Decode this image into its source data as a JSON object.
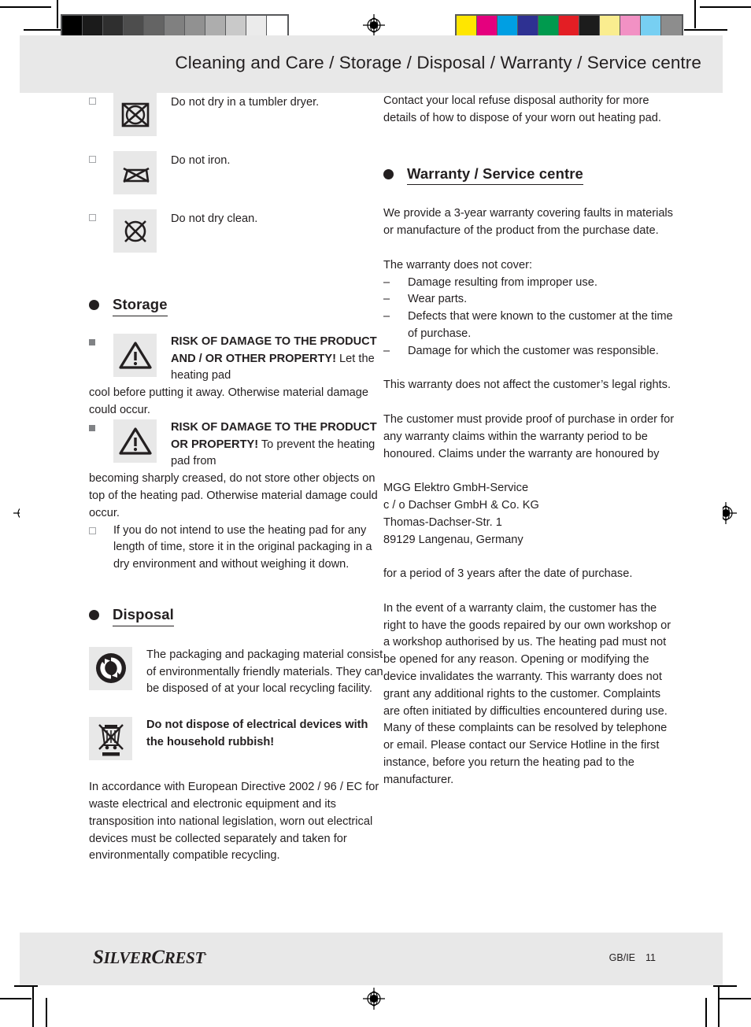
{
  "page": {
    "header_title": "Cleaning and Care / Storage / Disposal / Warranty / Service centre",
    "footer_logo_silver": "S",
    "footer_logo_ilver": "ILVER",
    "footer_logo_c": "C",
    "footer_logo_rest": "REST",
    "footer_logo_regmark": "·",
    "footer_locale": "GB/IE",
    "footer_pagenum": "11"
  },
  "calibration": {
    "gray_swatches": [
      "#000000",
      "#1b1b1b",
      "#2f2f2f",
      "#4d4d4d",
      "#646464",
      "#808080",
      "#919191",
      "#adadad",
      "#c9c9c9",
      "#ebebeb",
      "#ffffff"
    ],
    "color_swatches": [
      "#ffe600",
      "#e5007e",
      "#009fe3",
      "#2e3192",
      "#009a4e",
      "#e31e24",
      "#1c1c1c",
      "#faed8f",
      "#f291c4",
      "#77cff2",
      "#8d8d8d"
    ]
  },
  "left_column": {
    "care_symbols": [
      {
        "icon": "no-tumble-dry-icon",
        "label": "Do not dry in a tumbler dryer."
      },
      {
        "icon": "no-iron-icon",
        "label": "Do not iron."
      },
      {
        "icon": "no-dry-clean-icon",
        "label": "Do not dry clean."
      }
    ],
    "storage": {
      "heading": "Storage",
      "warning_1": {
        "strong": "RISK OF DAMAGE TO THE PRODUCT AND / OR OTHER PROPERTY!",
        "rest_inline": " Let the heating pad",
        "continuation": "cool before putting it away. Otherwise material damage could occur."
      },
      "warning_2": {
        "strong": "RISK OF DAMAGE TO THE PRODUCT OR PROPERTY!",
        "rest_inline": " To prevent the heating pad from",
        "continuation": "becoming sharply creased, do not store other objects on top of the heating pad. Otherwise material damage could occur."
      },
      "bullet_item": "If you do not intend to use the heating pad for any length of time, store it in the original packaging in a dry environment and without weighing it down."
    },
    "disposal": {
      "heading": "Disposal",
      "recycling_text": "The packaging and packaging material consist of environmentally friendly materials. They can be disposed of at your local recycling facility.",
      "weee_text": "Do not dispose of electrical devices with the household rubbish!",
      "directive_text": "In accordance with European Directive 2002 / 96 / EC for waste electrical and electronic equipment and its transposition into national legislation, worn out electrical devices must be collected separately and taken for environmentally compatible recycling."
    }
  },
  "right_column": {
    "refuse_text": "Contact your local refuse disposal authority for more details of how to dispose of your worn out heating pad.",
    "warranty": {
      "heading": "Warranty / Service centre",
      "intro": "We provide a 3-year warranty covering faults in materials or manufacture of the product from the purchase date.",
      "not_cover_label": "The warranty does not cover:",
      "not_cover_items": [
        "Damage resulting from improper use.",
        "Wear parts.",
        "Defects that were known to the customer at the time of purchase.",
        "Damage for which the customer was responsible."
      ],
      "legal_rights": "This warranty does not affect the customer’s legal rights.",
      "proof_of_purchase": "The customer must provide proof of purchase in order for any warranty claims within the warranty period to be honoured. Claims under the warranty are honoured by",
      "address": [
        "MGG Elektro GmbH-Service",
        "c / o Dachser GmbH & Co. KG",
        "Thomas-Dachser-Str. 1",
        "89129 Langenau, Germany"
      ],
      "period_note": "for a period of 3 years after the date of purchase.",
      "claim_text": "In the event of a warranty claim, the customer has the right to have the goods repaired by our own workshop or a workshop authorised by us. The heating pad must not be opened for any reason. Opening or modifying the device invalidates the warranty. This warranty does not grant any additional rights to the customer. Complaints are often initiated by difficulties encountered during use. Many of these complaints can be resolved by telephone or email. Please contact our Service Hotline in the first instance, before you return the heating pad to the manufacturer."
    }
  }
}
